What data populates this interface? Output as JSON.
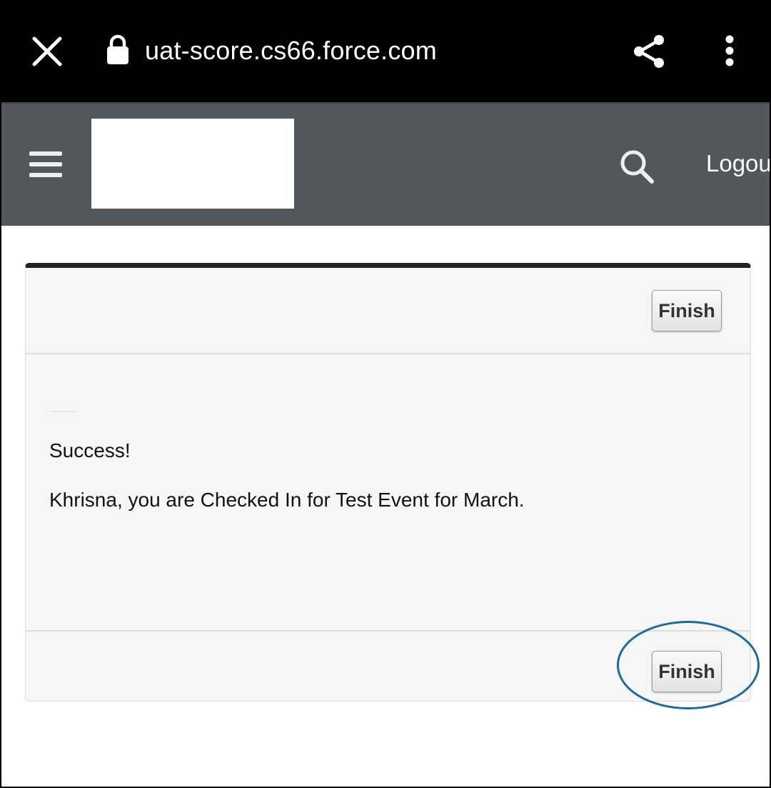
{
  "browser": {
    "url": "uat-score.cs66.force.com",
    "icons": {
      "close": "close-icon",
      "lock": "lock-icon",
      "share": "share-icon",
      "menu": "more-vert-icon"
    }
  },
  "header": {
    "logout_label": "Logou",
    "icons": {
      "menu": "hamburger-icon",
      "search": "search-icon"
    },
    "background": "#52575b"
  },
  "card": {
    "top_button_label": "Finish",
    "bottom_button_label": "Finish",
    "message_title": "Success!",
    "message_text": "Khrisna, you are Checked In for Test Event for March."
  },
  "colors": {
    "browser_bar": "#000000",
    "card_background": "#f6f6f6",
    "card_accent": "#222222",
    "highlight": "#1a6aa8"
  }
}
